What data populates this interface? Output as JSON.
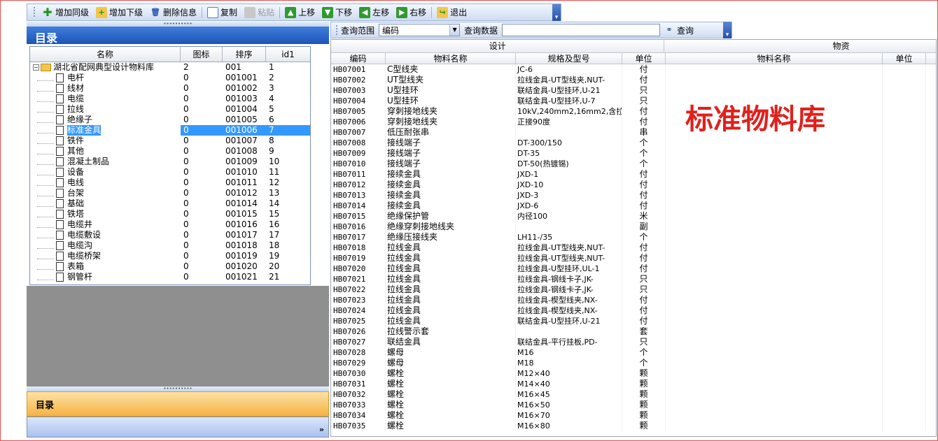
{
  "toolbar": {
    "buttons": [
      {
        "label": "增加同级",
        "icon": "plus-icon",
        "enabled": true
      },
      {
        "label": "增加下级",
        "icon": "add-child-icon",
        "enabled": true
      },
      {
        "label": "删除信息",
        "icon": "delete-icon",
        "enabled": true
      },
      {
        "label": "复制",
        "icon": "copy-icon",
        "enabled": true
      },
      {
        "label": "粘贴",
        "icon": "paste-icon",
        "enabled": false
      },
      {
        "label": "上移",
        "icon": "arrow-up-icon",
        "enabled": true
      },
      {
        "label": "下移",
        "icon": "arrow-down-icon",
        "enabled": true
      },
      {
        "label": "左移",
        "icon": "arrow-left-icon",
        "enabled": true
      },
      {
        "label": "右移",
        "icon": "arrow-right-icon",
        "enabled": true
      },
      {
        "label": "退出",
        "icon": "exit-icon",
        "enabled": true
      }
    ]
  },
  "left": {
    "title": "目录",
    "columns": [
      "名称",
      "图标",
      "排序",
      "id1"
    ],
    "root": {
      "name": "湖北省配网典型设计物料库",
      "icon": "2",
      "order": "001",
      "id": "1"
    },
    "items": [
      {
        "name": "电杆",
        "icon": "0",
        "order": "001001",
        "id": "2"
      },
      {
        "name": "线材",
        "icon": "0",
        "order": "001002",
        "id": "3"
      },
      {
        "name": "电缆",
        "icon": "0",
        "order": "001003",
        "id": "4"
      },
      {
        "name": "拉线",
        "icon": "0",
        "order": "001004",
        "id": "5"
      },
      {
        "name": "绝缘子",
        "icon": "0",
        "order": "001005",
        "id": "6"
      },
      {
        "name": "标准金具",
        "icon": "0",
        "order": "001006",
        "id": "7",
        "selected": true
      },
      {
        "name": "铁件",
        "icon": "0",
        "order": "001007",
        "id": "8"
      },
      {
        "name": "其他",
        "icon": "0",
        "order": "001008",
        "id": "9"
      },
      {
        "name": "混凝土制品",
        "icon": "0",
        "order": "001009",
        "id": "10"
      },
      {
        "name": "设备",
        "icon": "0",
        "order": "001010",
        "id": "11"
      },
      {
        "name": "电线",
        "icon": "0",
        "order": "001011",
        "id": "12"
      },
      {
        "name": "台架",
        "icon": "0",
        "order": "001012",
        "id": "13"
      },
      {
        "name": "基础",
        "icon": "0",
        "order": "001014",
        "id": "14"
      },
      {
        "name": "铁塔",
        "icon": "0",
        "order": "001015",
        "id": "15"
      },
      {
        "name": "电缆井",
        "icon": "0",
        "order": "001016",
        "id": "16"
      },
      {
        "name": "电缆敷设",
        "icon": "0",
        "order": "001017",
        "id": "17"
      },
      {
        "name": "电缆沟",
        "icon": "0",
        "order": "001018",
        "id": "18"
      },
      {
        "name": "电缆桥架",
        "icon": "0",
        "order": "001019",
        "id": "19"
      },
      {
        "name": "表箱",
        "icon": "0",
        "order": "001020",
        "id": "20"
      },
      {
        "name": "钢管杆",
        "icon": "0",
        "order": "001021",
        "id": "21"
      }
    ],
    "nav_label": "目录"
  },
  "query": {
    "range_label": "查询范围",
    "range_value": "编码",
    "data_label": "查询数据",
    "data_value": "",
    "search_label": "查询"
  },
  "grid": {
    "group_design": "设计",
    "group_material": "物资",
    "columns": [
      "编码",
      "物料名称",
      "规格及型号",
      "单位",
      "物料名称",
      "单位"
    ],
    "rows": [
      [
        "HB07001",
        "C型线夹",
        "JC-6",
        "付"
      ],
      [
        "HB07002",
        "UT型线夹",
        "拉线金具-UT型线夹,NUT-",
        "付"
      ],
      [
        "HB07003",
        "U型挂环",
        "联结金具-U型挂环,U-21",
        "只"
      ],
      [
        "HB07004",
        "U型挂环",
        "联结金具-U型挂环,U-7",
        "只"
      ],
      [
        "HB07005",
        "穿刺接地线夹",
        "10kV,240mm2,16mm2,含拉",
        "付"
      ],
      [
        "HB07006",
        "穿刺接地线夹",
        "正接90度",
        "付"
      ],
      [
        "HB07007",
        "低压耐张串",
        "",
        "串"
      ],
      [
        "HB07008",
        "接线端子",
        "DT-300/150",
        "个"
      ],
      [
        "HB07009",
        "接线端子",
        "DT-35",
        "个"
      ],
      [
        "HB07010",
        "接线端子",
        "DT-50(热镀锡)",
        "个"
      ],
      [
        "HB07011",
        "接续金具",
        "JXD-1",
        "付"
      ],
      [
        "HB07012",
        "接续金具",
        "JXD-10",
        "付"
      ],
      [
        "HB07013",
        "接续金具",
        "JXD-3",
        "付"
      ],
      [
        "HB07014",
        "接续金具",
        "JXD-6",
        "付"
      ],
      [
        "HB07015",
        "绝缘保护管",
        "内径100",
        "米"
      ],
      [
        "HB07016",
        "绝缘穿刺接地线夹",
        "",
        "副"
      ],
      [
        "HB07017",
        "绝缘压接线夹",
        "LH11-/35",
        "个"
      ],
      [
        "HB07018",
        "拉线金具",
        "拉线金具-UT型线夹,NUT-",
        "付"
      ],
      [
        "HB07019",
        "拉线金具",
        "拉线金具-UT型线夹,NUT-",
        "付"
      ],
      [
        "HB07020",
        "拉线金具",
        "拉线金具-U型挂环,UL-1",
        "付"
      ],
      [
        "HB07021",
        "拉线金具",
        "拉线金具-钢线卡子,JK-",
        "只"
      ],
      [
        "HB07022",
        "拉线金具",
        "拉线金具-钢线卡子,JK-",
        "只"
      ],
      [
        "HB07023",
        "拉线金具",
        "拉线金具-楔型线夹,NX-",
        "付"
      ],
      [
        "HB07024",
        "拉线金具",
        "拉线金具-楔型线夹,NX-",
        "付"
      ],
      [
        "HB07025",
        "拉线金具",
        "联结金具-U型挂环,U-21",
        "付"
      ],
      [
        "HB07026",
        "拉线警示套",
        "",
        "套"
      ],
      [
        "HB07027",
        "联结金具",
        "联结金具-平行挂板,PD-",
        "只"
      ],
      [
        "HB07028",
        "螺母",
        "M16",
        "个"
      ],
      [
        "HB07029",
        "螺母",
        "M18",
        "个"
      ],
      [
        "HB07030",
        "螺栓",
        "M12×40",
        "颗"
      ],
      [
        "HB07031",
        "螺栓",
        "M14×40",
        "颗"
      ],
      [
        "HB07032",
        "螺栓",
        "M16×45",
        "颗"
      ],
      [
        "HB07033",
        "螺栓",
        "M16×50",
        "颗"
      ],
      [
        "HB07034",
        "螺栓",
        "M16×70",
        "颗"
      ],
      [
        "HB07035",
        "螺栓",
        "M16×80",
        "颗"
      ]
    ]
  },
  "annotation": "标准物料库"
}
